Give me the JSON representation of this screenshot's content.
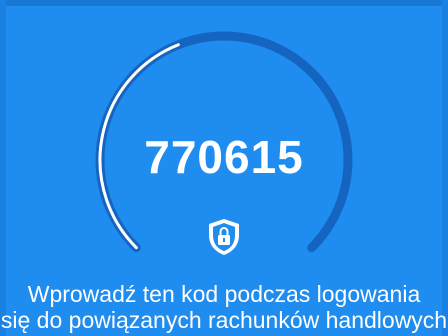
{
  "colors": {
    "background": "#1f8cf0",
    "gauge_track": "#1565c0",
    "gauge_arc": "#ffffff",
    "text": "#ffffff"
  },
  "otp": {
    "code": "770615",
    "progress_fraction": 0.42
  },
  "icons": {
    "lock": "shield-lock-icon"
  },
  "message": {
    "line1": "Wprowadź ten kod podczas logowania",
    "line2": "się do powiązanych rachunków handlowych"
  }
}
